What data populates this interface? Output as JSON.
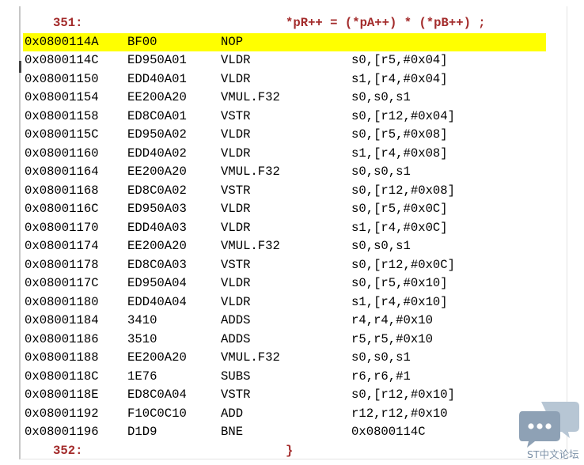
{
  "source_lines": {
    "start": {
      "line_no": "351:",
      "code": "*pR++ = (*pA++) * (*pB++) ;"
    },
    "end": {
      "line_no": "352:",
      "code": "}"
    }
  },
  "disassembly": [
    {
      "address": "0x0800114A",
      "opcode": "BF00",
      "mnemonic": "NOP",
      "operands": "",
      "current": true
    },
    {
      "address": "0x0800114C",
      "opcode": "ED950A01",
      "mnemonic": "VLDR",
      "operands": "s0,[r5,#0x04]"
    },
    {
      "address": "0x08001150",
      "opcode": "EDD40A01",
      "mnemonic": "VLDR",
      "operands": "s1,[r4,#0x04]"
    },
    {
      "address": "0x08001154",
      "opcode": "EE200A20",
      "mnemonic": "VMUL.F32",
      "operands": "s0,s0,s1"
    },
    {
      "address": "0x08001158",
      "opcode": "ED8C0A01",
      "mnemonic": "VSTR",
      "operands": "s0,[r12,#0x04]"
    },
    {
      "address": "0x0800115C",
      "opcode": "ED950A02",
      "mnemonic": "VLDR",
      "operands": "s0,[r5,#0x08]"
    },
    {
      "address": "0x08001160",
      "opcode": "EDD40A02",
      "mnemonic": "VLDR",
      "operands": "s1,[r4,#0x08]"
    },
    {
      "address": "0x08001164",
      "opcode": "EE200A20",
      "mnemonic": "VMUL.F32",
      "operands": "s0,s0,s1"
    },
    {
      "address": "0x08001168",
      "opcode": "ED8C0A02",
      "mnemonic": "VSTR",
      "operands": "s0,[r12,#0x08]"
    },
    {
      "address": "0x0800116C",
      "opcode": "ED950A03",
      "mnemonic": "VLDR",
      "operands": "s0,[r5,#0x0C]"
    },
    {
      "address": "0x08001170",
      "opcode": "EDD40A03",
      "mnemonic": "VLDR",
      "operands": "s1,[r4,#0x0C]"
    },
    {
      "address": "0x08001174",
      "opcode": "EE200A20",
      "mnemonic": "VMUL.F32",
      "operands": "s0,s0,s1"
    },
    {
      "address": "0x08001178",
      "opcode": "ED8C0A03",
      "mnemonic": "VSTR",
      "operands": "s0,[r12,#0x0C]"
    },
    {
      "address": "0x0800117C",
      "opcode": "ED950A04",
      "mnemonic": "VLDR",
      "operands": "s0,[r5,#0x10]"
    },
    {
      "address": "0x08001180",
      "opcode": "EDD40A04",
      "mnemonic": "VLDR",
      "operands": "s1,[r4,#0x10]"
    },
    {
      "address": "0x08001184",
      "opcode": "3410",
      "mnemonic": "ADDS",
      "operands": "r4,r4,#0x10"
    },
    {
      "address": "0x08001186",
      "opcode": "3510",
      "mnemonic": "ADDS",
      "operands": "r5,r5,#0x10"
    },
    {
      "address": "0x08001188",
      "opcode": "EE200A20",
      "mnemonic": "VMUL.F32",
      "operands": "s0,s0,s1"
    },
    {
      "address": "0x0800118C",
      "opcode": "1E76",
      "mnemonic": "SUBS",
      "operands": "r6,r6,#1"
    },
    {
      "address": "0x0800118E",
      "opcode": "ED8C0A04",
      "mnemonic": "VSTR",
      "operands": "s0,[r12,#0x10]"
    },
    {
      "address": "0x08001192",
      "opcode": "F10C0C10",
      "mnemonic": "ADD",
      "operands": "r12,r12,#0x10"
    },
    {
      "address": "0x08001196",
      "opcode": "D1D9",
      "mnemonic": "BNE",
      "operands": "0x0800114C"
    }
  ],
  "watermark": {
    "text": "ST中文论坛",
    "icon": "chat-bubbles-icon"
  },
  "colors": {
    "source_text": "#a32b2b",
    "current_line_highlight": "#ffff00",
    "logo": "#9fb1c3"
  }
}
